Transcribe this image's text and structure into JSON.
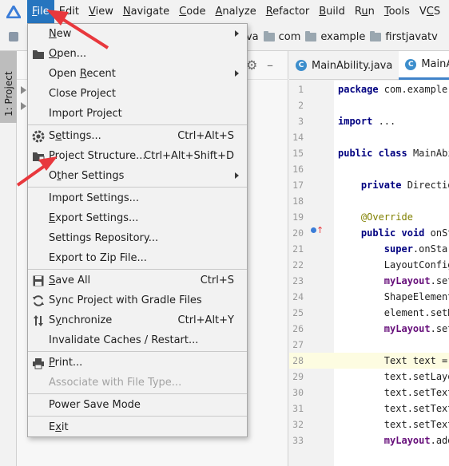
{
  "menubar": {
    "items": [
      "File",
      "Edit",
      "View",
      "Navigate",
      "Code",
      "Analyze",
      "Refactor",
      "Build",
      "Run",
      "Tools",
      "VCS"
    ],
    "active": "File"
  },
  "breadcrumb": {
    "first_letter": "F",
    "items": [
      "ava",
      "com",
      "example",
      "firstjavatv"
    ]
  },
  "left_strip": {
    "project_tab_label": "1: Project"
  },
  "editor": {
    "tabs": [
      {
        "label": "MainAbility.java",
        "icon": "C"
      },
      {
        "label": "MainA",
        "icon": "C"
      }
    ],
    "line_numbers": [
      "1",
      "2",
      "3",
      "14",
      "15",
      "16",
      "17",
      "18",
      "19",
      "20",
      "21",
      "22",
      "23",
      "24",
      "25",
      "26",
      "27",
      "28",
      "29",
      "30",
      "31",
      "32",
      "33"
    ],
    "code": [
      "package com.example.",
      "",
      "import ...",
      "",
      "public class MainAbi",
      "",
      "    private Directio",
      "",
      "    @Override",
      "    public void onSt",
      "        super.onStar",
      "        LayoutConfig",
      "        myLayout.set",
      "        ShapeElement",
      "        element.setR",
      "        myLayout.set",
      "",
      "        Text text = ",
      "        text.setLayo",
      "        text.setText",
      "        text.setText",
      "        text.setText",
      "        myLayout.add"
    ]
  },
  "file_menu": {
    "items": [
      {
        "label": "New",
        "mnemonic_index": 0,
        "shortcut": "",
        "submenu": true,
        "icon": "",
        "disabled": false
      },
      {
        "label": "Open...",
        "mnemonic_index": 0,
        "shortcut": "",
        "submenu": false,
        "icon": "folder-open-icon",
        "disabled": false
      },
      {
        "label": "Open Recent",
        "mnemonic_index": 5,
        "shortcut": "",
        "submenu": true,
        "icon": "",
        "disabled": false
      },
      {
        "label": "Close Project",
        "mnemonic_index": -1,
        "shortcut": "",
        "submenu": false,
        "icon": "",
        "disabled": false
      },
      {
        "label": "Import Project",
        "mnemonic_index": -1,
        "shortcut": "",
        "submenu": false,
        "icon": "",
        "disabled": false
      },
      {
        "label": "Settings...",
        "mnemonic_index": 1,
        "shortcut": "Ctrl+Alt+S",
        "submenu": false,
        "icon": "gear-icon",
        "disabled": false
      },
      {
        "label": "Project Structure...",
        "mnemonic_index": -1,
        "shortcut": "Ctrl+Alt+Shift+D",
        "submenu": false,
        "icon": "project-structure-icon",
        "disabled": false
      },
      {
        "label": "Other Settings",
        "mnemonic_index": 1,
        "shortcut": "",
        "submenu": true,
        "icon": "",
        "disabled": false
      },
      {
        "label": "Import Settings...",
        "mnemonic_index": -1,
        "shortcut": "",
        "submenu": false,
        "icon": "",
        "disabled": false
      },
      {
        "label": "Export Settings...",
        "mnemonic_index": 0,
        "shortcut": "",
        "submenu": false,
        "icon": "",
        "disabled": false
      },
      {
        "label": "Settings Repository...",
        "mnemonic_index": -1,
        "shortcut": "",
        "submenu": false,
        "icon": "",
        "disabled": false
      },
      {
        "label": "Export to Zip File...",
        "mnemonic_index": -1,
        "shortcut": "",
        "submenu": false,
        "icon": "",
        "disabled": false
      },
      {
        "label": "Save All",
        "mnemonic_index": 0,
        "shortcut": "Ctrl+S",
        "submenu": false,
        "icon": "save-icon",
        "disabled": false
      },
      {
        "label": "Sync Project with Gradle Files",
        "mnemonic_index": -1,
        "shortcut": "",
        "submenu": false,
        "icon": "sync-icon",
        "disabled": false
      },
      {
        "label": "Synchronize",
        "mnemonic_index": 1,
        "shortcut": "Ctrl+Alt+Y",
        "submenu": false,
        "icon": "synchronize-icon",
        "disabled": false
      },
      {
        "label": "Invalidate Caches / Restart...",
        "mnemonic_index": -1,
        "shortcut": "",
        "submenu": false,
        "icon": "",
        "disabled": false
      },
      {
        "label": "Print...",
        "mnemonic_index": 0,
        "shortcut": "",
        "submenu": false,
        "icon": "print-icon",
        "disabled": false
      },
      {
        "label": "Associate with File Type...",
        "mnemonic_index": -1,
        "shortcut": "",
        "submenu": false,
        "icon": "",
        "disabled": true
      },
      {
        "label": "Power Save Mode",
        "mnemonic_index": -1,
        "shortcut": "",
        "submenu": false,
        "icon": "",
        "disabled": false
      },
      {
        "label": "Exit",
        "mnemonic_index": 1,
        "shortcut": "",
        "submenu": false,
        "icon": "",
        "disabled": false
      }
    ]
  },
  "colors": {
    "menu_highlight": "#2675bf",
    "annotation_arrow": "#e8383d",
    "tab_underline": "#4083c9",
    "keyword": "#000080",
    "field": "#660e7a",
    "annotation": "#808000"
  }
}
